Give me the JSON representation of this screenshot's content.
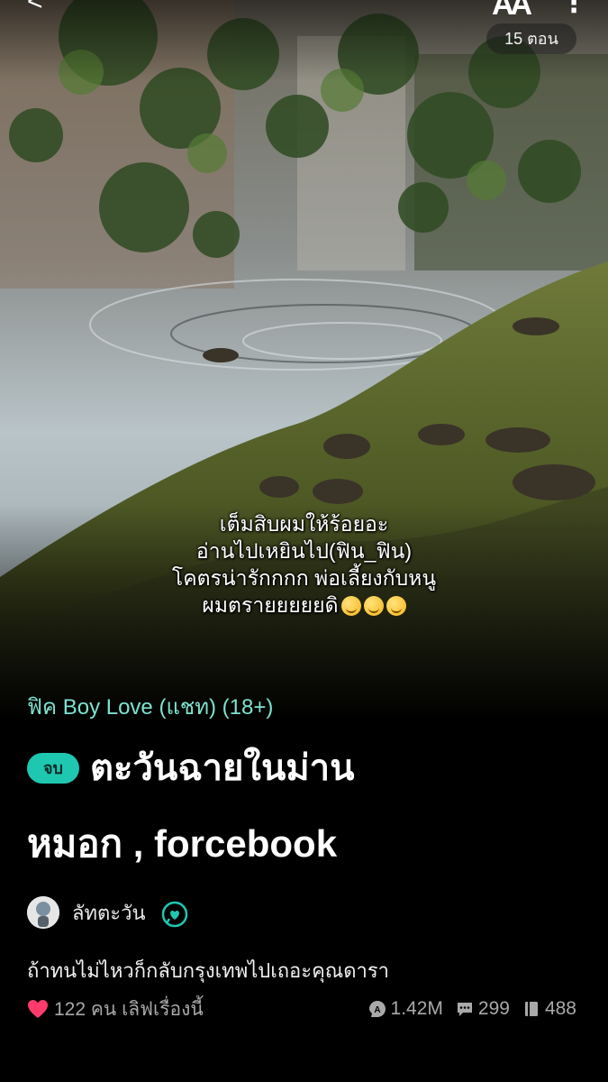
{
  "header": {
    "back_glyph": "<",
    "font_glyph": "AA",
    "more_glyph": "⋮",
    "episode_count": "15 ตอน"
  },
  "cover": {
    "overlay_text": "เต็มสิบผมให้ร้อยอะ\nอ่านไปเหยินไป(ฟิน_ฟิน)\nโคตรน่ารักกกก พ่อเลี้ยงกับหนู\nผมตรายยยยยดิ"
  },
  "story": {
    "category": "ฟิค Boy Love (แชท) (18+)",
    "status_badge": "จบ",
    "title_line1": "ตะวันฉายในม่าน",
    "title_line2": "หมอก , forcebook",
    "author": "ลัทตะวัน",
    "synopsis": "ถ้าทนไม่ไหวก็กลับกรุงเทพไปเถอะคุณดารา",
    "likes": "122 คน เลิฟเรื่องนี้",
    "views": "1.42M",
    "comments": "299",
    "chapters": "488"
  },
  "colors": {
    "accent": "#1ec7b0",
    "category_text": "#7de3cf",
    "heart": "#ff3b6b",
    "muted": "#a9a9a9"
  },
  "icons": [
    "back-icon",
    "font-size-icon",
    "more-icon",
    "chat-icon",
    "heart-icon",
    "views-icon",
    "comment-icon",
    "chapter-icon"
  ]
}
